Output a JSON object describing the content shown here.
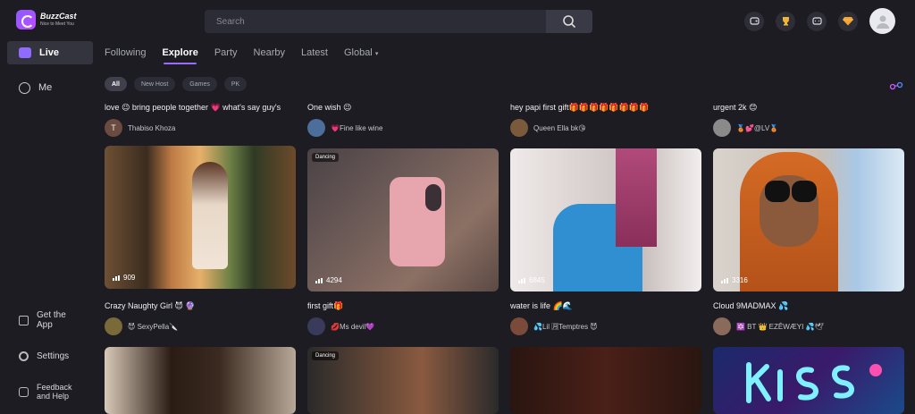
{
  "app": {
    "name": "BuzzCast",
    "tagline": "Nice to Meet You"
  },
  "search": {
    "placeholder": "Search"
  },
  "sidebar": {
    "items": [
      {
        "label": "Live",
        "icon": "live-icon"
      },
      {
        "label": "Me",
        "icon": "profile-icon"
      },
      {
        "label": "Get the App",
        "icon": "app-grid-icon"
      },
      {
        "label": "Settings",
        "icon": "settings-icon"
      },
      {
        "label": "Feedback and Help",
        "icon": "feedback-icon"
      }
    ]
  },
  "tabs": [
    "Following",
    "Explore",
    "Party",
    "Nearby",
    "Latest",
    "Global"
  ],
  "chips": [
    "All",
    "New Host",
    "Games",
    "PK"
  ],
  "cards": [
    {
      "title": "love 😉 bring people together 💗 what's say guy's",
      "host": "Thabiso Khoza",
      "host_initial": "T",
      "viewers": "909",
      "badge": ""
    },
    {
      "title": "One wish 😉",
      "host": "💗Fine like wine",
      "host_initial": "",
      "viewers": "4294",
      "badge": "Dancing"
    },
    {
      "title": "hey papi first gift🎁🎁🎁🎁🎁🎁🎁🎁",
      "host": "Queen Ella bk😘",
      "host_initial": "",
      "viewers": "6845",
      "badge": ""
    },
    {
      "title": "urgent 2k 😊",
      "host": "🥉💕@LV🥉",
      "host_initial": "",
      "viewers": "3316",
      "badge": ""
    },
    {
      "title": "Crazy Naughty Girl 😈 🔮",
      "host": "😈 SexyPella🔪",
      "host_initial": "",
      "viewers": "",
      "badge": ""
    },
    {
      "title": "first gift🎁",
      "host": "💋Ms devil💜",
      "host_initial": "",
      "viewers": "",
      "badge": "Dancing"
    },
    {
      "title": "water is life 🌈🌊",
      "host": "💦Lil 🈷Temptres 😈",
      "host_initial": "",
      "viewers": "",
      "badge": ""
    },
    {
      "title": "Cloud 9MADMAX 💦",
      "host": "🔯 BT 👑 EZÊWÆYI 💦🕊",
      "host_initial": "",
      "viewers": "",
      "badge": ""
    }
  ],
  "colors": {
    "accent": "#9b6bff",
    "background": "#1c1c22",
    "sidebar_active": "#34343e"
  }
}
